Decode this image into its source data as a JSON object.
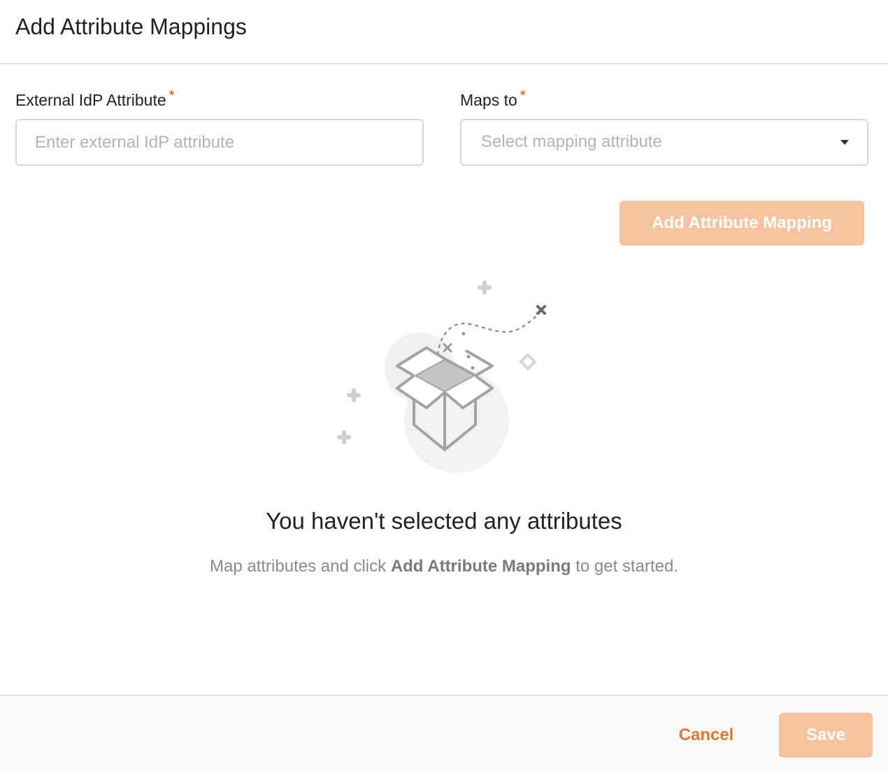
{
  "dialog": {
    "title": "Add Attribute Mappings"
  },
  "form": {
    "external_label": "External IdP Attribute",
    "external_placeholder": "Enter external IdP attribute",
    "external_value": "",
    "maps_to_label": "Maps to",
    "maps_to_placeholder": "Select mapping attribute",
    "required_marker": "*",
    "add_button_label": "Add Attribute Mapping"
  },
  "empty_state": {
    "illustration_icon": "open-box-icon",
    "title": "You haven't selected any attributes",
    "desc_before": "Map attributes and click ",
    "desc_bold": "Add Attribute Mapping",
    "desc_after": " to get started."
  },
  "footer": {
    "cancel_label": "Cancel",
    "save_label": "Save"
  },
  "colors": {
    "accent": "#e8772e",
    "accent_disabled": "#f6c3a0",
    "required": "#d9480f",
    "placeholder": "#b3b3b3"
  }
}
